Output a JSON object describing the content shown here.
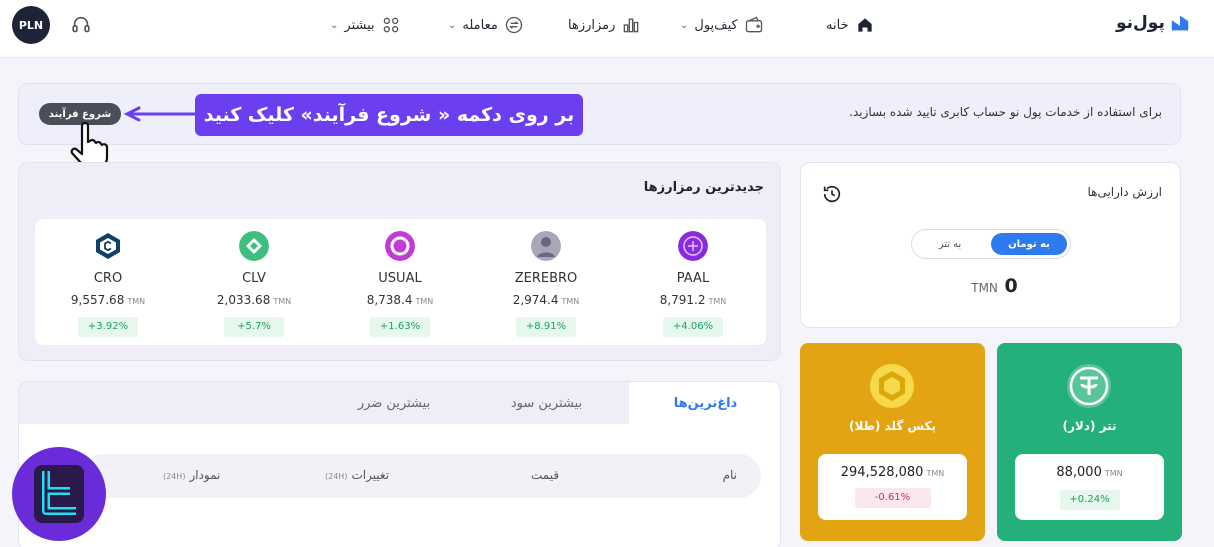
{
  "header": {
    "avatar": "PLN",
    "logo": "پول‌نو",
    "nav": {
      "home": "خانه",
      "wallet": "کیف‌پول",
      "cryptos": "رمزارزها",
      "trade": "معامله",
      "more": "بیشتر"
    }
  },
  "banner": {
    "text": "برای استفاده از خدمات پول نو حساب کابری تایید شده بسازید.",
    "button": "شروع فرآیند",
    "callout": "بر روی دکمه « شروع فرآیند» کلیک کنید"
  },
  "newest": {
    "title": "جدیدترین رمزارزها",
    "unit": "TMN",
    "coins": [
      {
        "name": "PAAL",
        "price": "8,791.2",
        "change": "+4.06%"
      },
      {
        "name": "ZEREBRO",
        "price": "2,974.4",
        "change": "+8.91%"
      },
      {
        "name": "USUAL",
        "price": "8,738.4",
        "change": "+1.63%"
      },
      {
        "name": "CLV",
        "price": "2,033.68",
        "change": "+5.7%"
      },
      {
        "name": "CRO",
        "price": "9,557.68",
        "change": "+3.92%"
      }
    ]
  },
  "assets": {
    "title": "ارزش دارایی‌ها",
    "toggle_toman": "به تومان",
    "toggle_tether": "به تتر",
    "value": "0",
    "unit": "TMN"
  },
  "cards": {
    "tether": {
      "name": "تتر (دلار)",
      "price": "88,000",
      "unit": "TMN",
      "change": "+0.24%"
    },
    "gold": {
      "name": "پکس گلد (طلا)",
      "price": "294,528,080",
      "unit": "TMN",
      "change": "-0.61%"
    }
  },
  "market_tabs": {
    "hot": "داغ‌ترین‌ها",
    "gainers": "بیشترین سود",
    "losers": "بیشترین ضرر"
  },
  "table_head": {
    "name": "نام",
    "price": "قیمت",
    "change": "تغییرات",
    "chart": "نمودار",
    "period": "(24H)"
  },
  "colors": {
    "accent": "#2e7bf0",
    "callout": "#6b3ff0",
    "gold": "#e2a413",
    "tether": "#23b07a",
    "positive": "#1aa35a",
    "negative": "#d12c5a"
  }
}
